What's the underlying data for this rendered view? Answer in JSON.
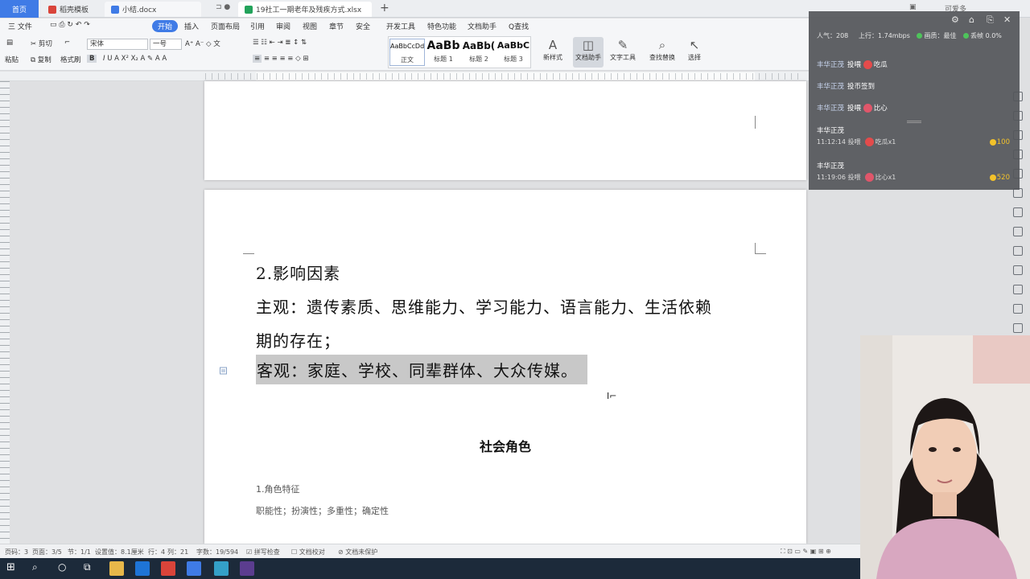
{
  "tabs": {
    "home": "首页",
    "items": [
      {
        "label": "稻壳模板",
        "color": "#d9443a"
      },
      {
        "label": "小结.docx",
        "color": "#3f7be6"
      },
      {
        "label": "19社工一期老年及残疾方式.xlsx",
        "color": "#23a35b"
      }
    ],
    "plus": "+",
    "user": "可爱多"
  },
  "menu": {
    "file": "三 文件",
    "items": [
      "开始",
      "插入",
      "页面布局",
      "引用",
      "审阅",
      "视图",
      "章节",
      "安全",
      "开发工具",
      "特色功能",
      "文档助手",
      "Q查找"
    ],
    "active": "开始"
  },
  "ribbon": {
    "paste": "粘贴",
    "cut": "剪切",
    "copy": "复制",
    "format_painter": "格式刷",
    "font_name": "宋体",
    "font_size": "一号",
    "styles": [
      {
        "preview": "AaBbCcDd",
        "label": "正文"
      },
      {
        "preview": "AaBb",
        "label": "标题 1"
      },
      {
        "preview": "AaBb(",
        "label": "标题 2"
      },
      {
        "preview": "AaBbC",
        "label": "标题 3"
      }
    ],
    "tools": [
      {
        "label": "新样式",
        "glyph": "A"
      },
      {
        "label": "文档助手",
        "glyph": "◫"
      },
      {
        "label": "文字工具",
        "glyph": "✎"
      },
      {
        "label": "查找替换",
        "glyph": "⌕"
      },
      {
        "label": "选择",
        "glyph": "↖"
      }
    ]
  },
  "document": {
    "lines": [
      "2.影响因素",
      "主观：遗传素质、思维能力、学习能力、语言能力、生活依赖",
      "期的存在；",
      "客观：家庭、学校、同辈群体、大众传媒。"
    ],
    "section_title": "社会角色",
    "small_lines": [
      "1.角色特征",
      "职能性；扮演性；多重性；确定性"
    ]
  },
  "live": {
    "stats": {
      "popularity": "人气：208",
      "upload": "上行：1.74mbps",
      "screen": "画质：最佳",
      "drop": "丢帧 0.0%"
    },
    "messages": [
      {
        "user": "丰华正茂",
        "text": "投喂",
        "gift": "吃瓜"
      },
      {
        "user": "丰华正茂",
        "text": "投币签到",
        "gift": ""
      },
      {
        "user": "丰华正茂",
        "text": "投喂",
        "gift": "比心"
      }
    ],
    "gifts": [
      {
        "user": "丰华正茂",
        "time": "11:12:14 投喂",
        "gift": "吃瓜x1",
        "value": "100"
      },
      {
        "user": "丰华正茂",
        "time": "11:19:06 投喂",
        "gift": "比心x1",
        "value": "520"
      }
    ]
  },
  "status": {
    "page_no": "页码：3",
    "pages": "页面：3/5",
    "section": "节：1/1",
    "setting": "设置值：8.1厘米",
    "row": "行：4",
    "col": "列：21",
    "words": "字数：19/594",
    "spell": "拼写检查",
    "proof": "文档校对",
    "unsaved": "文档未保护"
  },
  "accent_color": "#3f7be6",
  "selection_color": "#c8c8c8"
}
